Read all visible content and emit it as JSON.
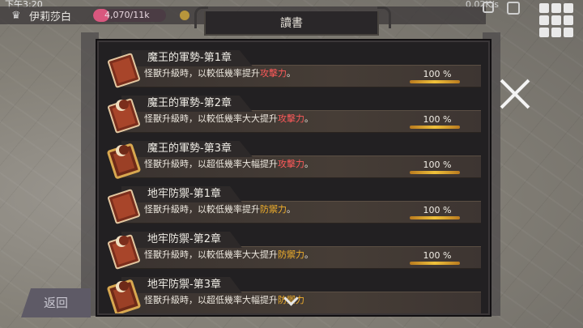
{
  "status_bar": {
    "time": "下午3:20",
    "network": "0.02K/s"
  },
  "player": {
    "name": "伊莉莎白",
    "exp_text": "4,070/11k",
    "exp_fraction": 0.22
  },
  "modal": {
    "title": "讀書"
  },
  "back_button": {
    "label": "返回"
  },
  "colors": {
    "attack": "#ff5a5a",
    "defense": "#f2b02b",
    "progress_bar": "#f0c23b"
  },
  "books": [
    {
      "title": "魔王的軍勢-第1章",
      "desc_prefix": "怪獸升級時，以較低幾率提升",
      "stat": "攻擊力",
      "stat_type": "attack",
      "suffix": "。",
      "percent": "100 %",
      "icon": "red-book-icon"
    },
    {
      "title": "魔王的軍勢-第2章",
      "desc_prefix": "怪獸升級時，以較低幾率大大提升",
      "stat": "攻擊力",
      "stat_type": "attack",
      "suffix": "。",
      "percent": "100 %",
      "icon": "red-book-crescent-icon"
    },
    {
      "title": "魔王的軍勢-第3章",
      "desc_prefix": "怪獸升級時，以超低幾率大幅提升",
      "stat": "攻擊力",
      "stat_type": "attack",
      "suffix": "。",
      "percent": "100 %",
      "icon": "ornate-book-icon"
    },
    {
      "title": "地牢防禦-第1章",
      "desc_prefix": "怪獸升級時，以較低幾率提升",
      "stat": "防禦力",
      "stat_type": "defense",
      "suffix": "。",
      "percent": "100 %",
      "icon": "red-book-icon"
    },
    {
      "title": "地牢防禦-第2章",
      "desc_prefix": "怪獸升級時，以較低幾率大大提升",
      "stat": "防禦力",
      "stat_type": "defense",
      "suffix": "。",
      "percent": "100 %",
      "icon": "red-book-crescent-icon"
    },
    {
      "title": "地牢防禦-第3章",
      "desc_prefix": "怪獸升級時，以超低幾率大幅提升",
      "stat": "防禦力",
      "stat_type": "defense",
      "suffix": "",
      "percent": "",
      "icon": "ornate-book-icon"
    }
  ]
}
